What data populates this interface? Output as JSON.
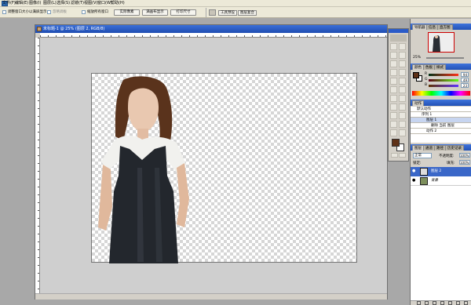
{
  "menu": {
    "items": [
      "文件(F)",
      "编辑(E)",
      "图像(I)",
      "图层(L)",
      "选择(S)",
      "滤镜(T)",
      "视图(V)",
      "窗口(W)",
      "帮助(H)"
    ]
  },
  "options": {
    "resize_windows": "调整窗口大小以满屏显示",
    "ignore_palettes": "忽略调板",
    "zoom_all": "缩放所有窗口",
    "actual_pixels": "实际像素",
    "fit_screen": "满画布显示",
    "print_size": "打印尺寸",
    "tab_tool_presets": "工具预设",
    "tab_layer_comps": "图层复合"
  },
  "document": {
    "title": "未标题-1 @ 25% (图层 2, RGB/8)",
    "zoom_status": "25%"
  },
  "navigator": {
    "tabs": [
      "导航器",
      "信息",
      "直方图"
    ],
    "zoom": "25%"
  },
  "color": {
    "tabs": [
      "颜色",
      "色板",
      "样式"
    ],
    "r_label": "R",
    "g_label": "G",
    "b_label": "B",
    "r": "94",
    "g": "49",
    "b": "23",
    "fg_color": "#5e3117",
    "bg_color": "#ffffff"
  },
  "actions": {
    "tabs": [
      "动作"
    ],
    "items": [
      "默认动作",
      "序列 1",
      "图层 1",
      "删除 当前 图层",
      "动作 2"
    ]
  },
  "layers": {
    "tabs": [
      "图层",
      "通道",
      "路径",
      "历史记录"
    ],
    "blend_mode": "正常",
    "opacity_label": "不透明度:",
    "opacity": "100%",
    "lock_label": "锁定:",
    "fill_label": "填充:",
    "fill": "100%",
    "items": [
      "图层 2",
      "背景"
    ]
  }
}
